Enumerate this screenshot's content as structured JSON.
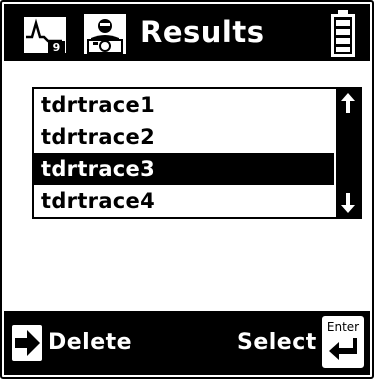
{
  "header": {
    "trace_icon_digit": "9",
    "title": "Results",
    "icons": [
      "trace-icon",
      "camera-icon",
      "battery-icon"
    ]
  },
  "list": {
    "items": [
      {
        "label": "tdrtrace1",
        "selected": false
      },
      {
        "label": "tdrtrace2",
        "selected": false
      },
      {
        "label": "tdrtrace3",
        "selected": true
      },
      {
        "label": "tdrtrace4",
        "selected": false
      }
    ],
    "scroll_icons": [
      "arrow-up-icon",
      "arrow-down-icon"
    ]
  },
  "footer": {
    "delete_label": "Delete",
    "select_label": "Select",
    "enter_key_label": "Enter",
    "icons": [
      "right-arrow-icon",
      "enter-key-icon"
    ]
  },
  "colors": {
    "background": "#ffffff",
    "bar": "#000000",
    "text_on_bar": "#ffffff",
    "selected_row": "#000000"
  }
}
